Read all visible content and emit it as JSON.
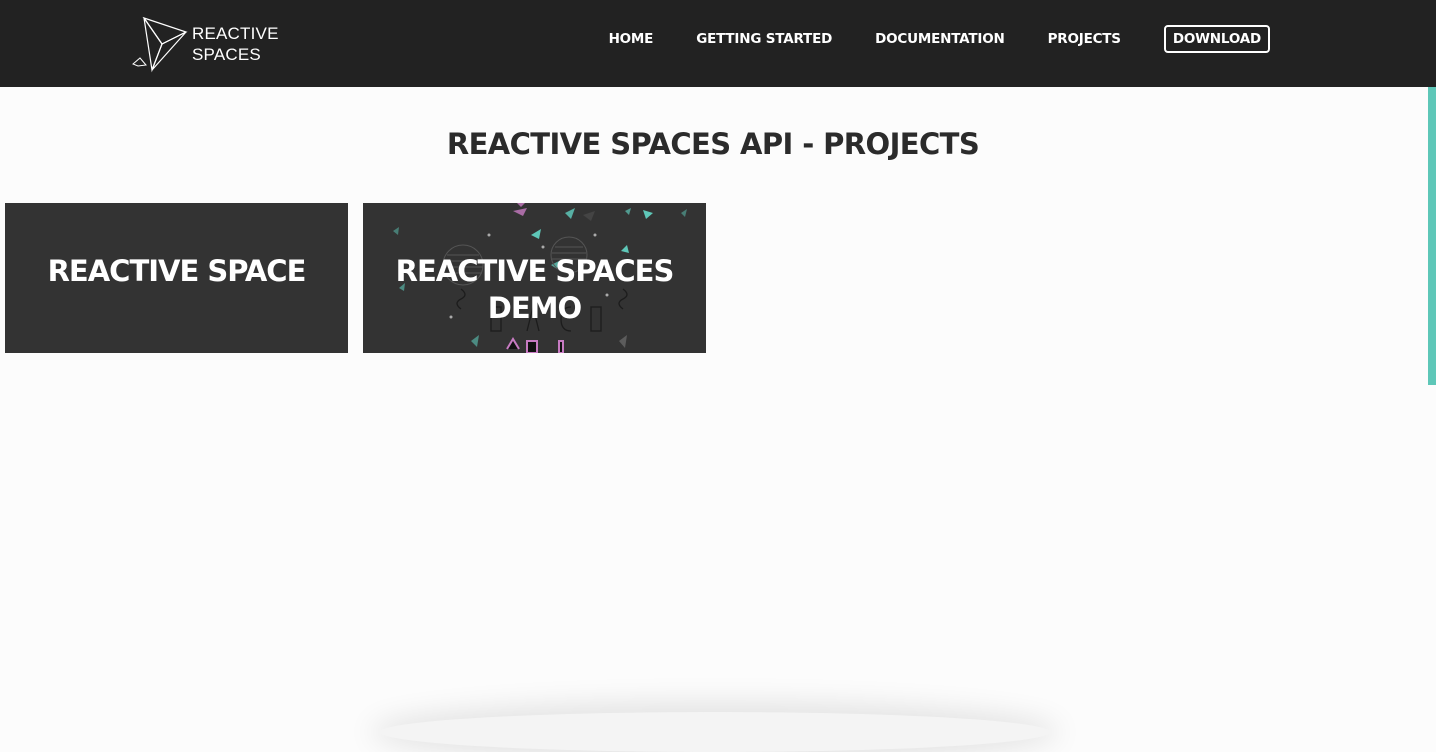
{
  "brand": {
    "line1": "REACTIVE",
    "line2": "SPACES"
  },
  "nav": {
    "items": [
      {
        "label": "HOME"
      },
      {
        "label": "GETTING STARTED"
      },
      {
        "label": "DOCUMENTATION"
      },
      {
        "label": "PROJECTS"
      }
    ],
    "download_label": "DOWNLOAD"
  },
  "main": {
    "title": "REACTIVE SPACES API - PROJECTS",
    "cards": [
      {
        "title": "REACTIVE SPACE"
      },
      {
        "title": "REACTIVE SPACES DEMO"
      }
    ]
  },
  "colors": {
    "navbar": "#222222",
    "accent": "#5ec7b8",
    "card": "#333333",
    "highlight": "#c77bc2"
  }
}
